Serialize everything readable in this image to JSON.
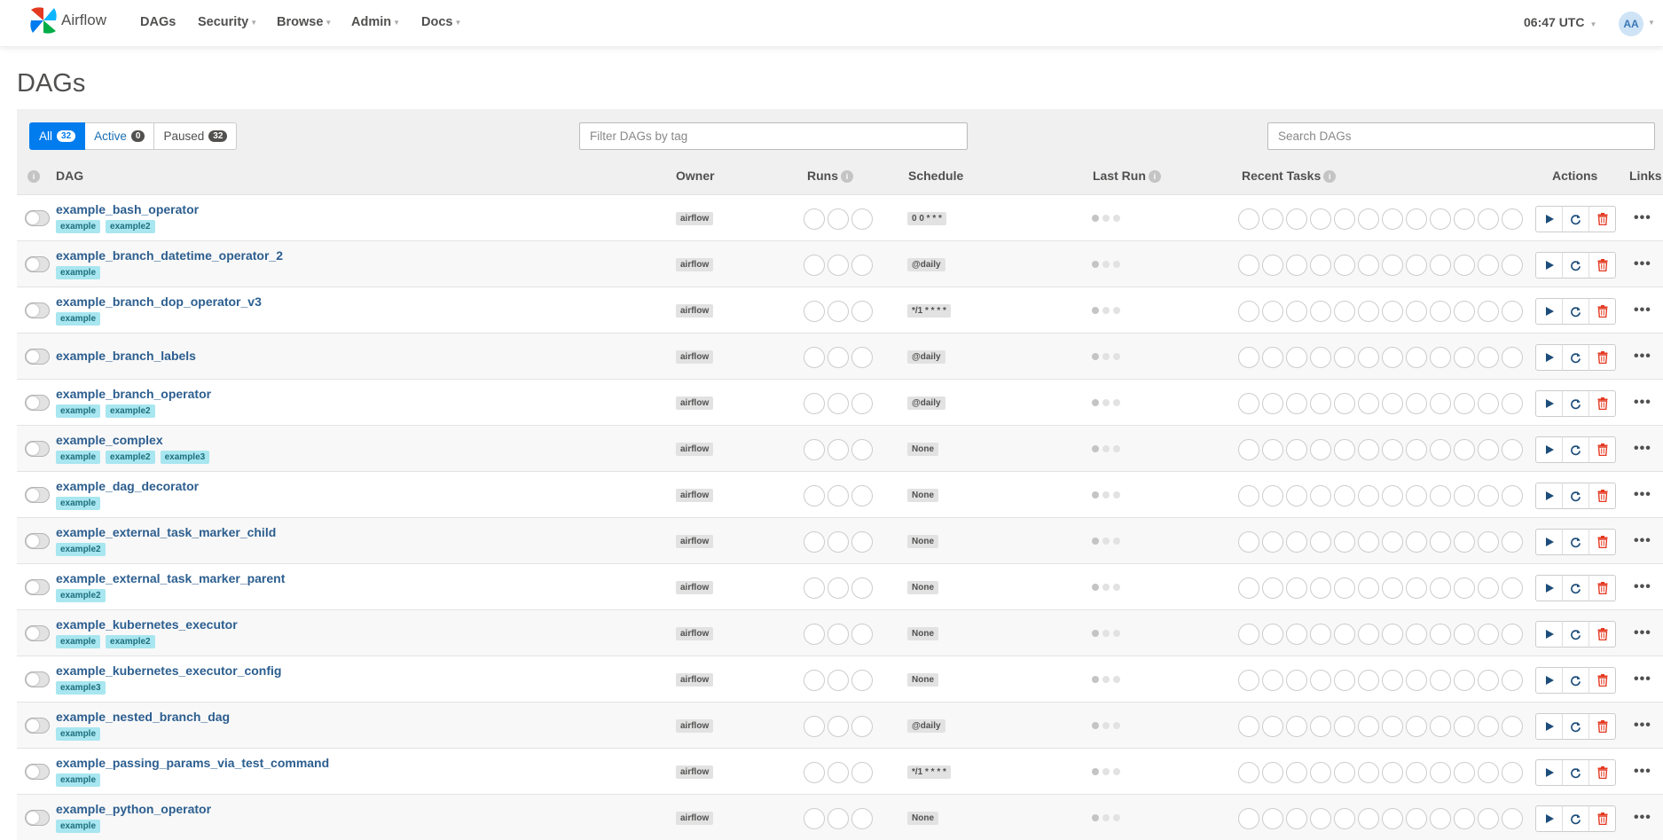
{
  "nav": {
    "brand": "Airflow",
    "items": [
      {
        "label": "DAGs",
        "has_caret": false
      },
      {
        "label": "Security",
        "has_caret": true
      },
      {
        "label": "Browse",
        "has_caret": true
      },
      {
        "label": "Admin",
        "has_caret": true
      },
      {
        "label": "Docs",
        "has_caret": true
      }
    ],
    "time": "06:47 UTC",
    "avatar": "AA"
  },
  "page": {
    "title": "DAGs"
  },
  "filters": {
    "all": {
      "label": "All",
      "count": "32"
    },
    "active": {
      "label": "Active",
      "count": "0"
    },
    "paused": {
      "label": "Paused",
      "count": "32"
    },
    "tag_placeholder": "Filter DAGs by tag",
    "search_placeholder": "Search DAGs"
  },
  "table": {
    "headers": {
      "info": "i",
      "dag": "DAG",
      "owner": "Owner",
      "runs": "Runs",
      "schedule": "Schedule",
      "last_run": "Last Run",
      "recent_tasks": "Recent Tasks",
      "actions": "Actions",
      "links": "Links"
    },
    "rows": [
      {
        "dag_id": "example_bash_operator",
        "tags": [
          "example",
          "example2"
        ],
        "owner": "airflow",
        "schedule": "0 0 * * *"
      },
      {
        "dag_id": "example_branch_datetime_operator_2",
        "tags": [
          "example"
        ],
        "owner": "airflow",
        "schedule": "@daily"
      },
      {
        "dag_id": "example_branch_dop_operator_v3",
        "tags": [
          "example"
        ],
        "owner": "airflow",
        "schedule": "*/1 * * * *"
      },
      {
        "dag_id": "example_branch_labels",
        "tags": [],
        "owner": "airflow",
        "schedule": "@daily"
      },
      {
        "dag_id": "example_branch_operator",
        "tags": [
          "example",
          "example2"
        ],
        "owner": "airflow",
        "schedule": "@daily"
      },
      {
        "dag_id": "example_complex",
        "tags": [
          "example",
          "example2",
          "example3"
        ],
        "owner": "airflow",
        "schedule": "None"
      },
      {
        "dag_id": "example_dag_decorator",
        "tags": [
          "example"
        ],
        "owner": "airflow",
        "schedule": "None"
      },
      {
        "dag_id": "example_external_task_marker_child",
        "tags": [
          "example2"
        ],
        "owner": "airflow",
        "schedule": "None"
      },
      {
        "dag_id": "example_external_task_marker_parent",
        "tags": [
          "example2"
        ],
        "owner": "airflow",
        "schedule": "None"
      },
      {
        "dag_id": "example_kubernetes_executor",
        "tags": [
          "example",
          "example2"
        ],
        "owner": "airflow",
        "schedule": "None"
      },
      {
        "dag_id": "example_kubernetes_executor_config",
        "tags": [
          "example3"
        ],
        "owner": "airflow",
        "schedule": "None"
      },
      {
        "dag_id": "example_nested_branch_dag",
        "tags": [
          "example"
        ],
        "owner": "airflow",
        "schedule": "@daily"
      },
      {
        "dag_id": "example_passing_params_via_test_command",
        "tags": [
          "example"
        ],
        "owner": "airflow",
        "schedule": "*/1 * * * *"
      },
      {
        "dag_id": "example_python_operator",
        "tags": [
          "example"
        ],
        "owner": "airflow",
        "schedule": "None"
      }
    ]
  },
  "colors": {
    "accent": "#017cee",
    "tag_bg": "#a8e6f0",
    "delete": "#e43921",
    "link": "#2c5e8f"
  },
  "icons": {
    "trigger": "play-icon",
    "refresh": "refresh-icon",
    "delete": "trash-icon",
    "links": "more-icon"
  }
}
